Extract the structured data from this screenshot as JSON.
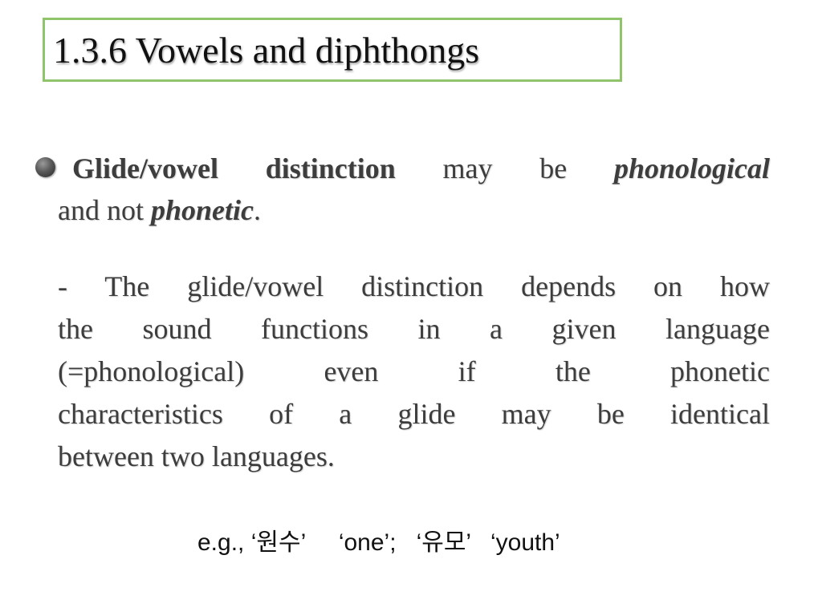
{
  "slide": {
    "title": "1.3.6 Vowels and diphthongs",
    "main_point": {
      "part1_bold": "Glide/vowel distinction",
      "part2": " may be ",
      "part3_bold_italic": "phonological",
      "part4": "and not ",
      "part5_bold_italic": "phonetic",
      "part6": "."
    },
    "sub_point": {
      "line1": "- The glide/vowel distinction depends on how",
      "line2": "the sound functions in a given language",
      "line3": "(=phonological) even if the phonetic",
      "line4": "characteristics of a glide may be identical",
      "line5": "between two languages."
    },
    "example": {
      "prefix": "e.g., ",
      "korean1": "‘원수’",
      "gloss1": "‘one’;",
      "korean2": "‘유모’",
      "gloss2": "‘youth’"
    }
  }
}
